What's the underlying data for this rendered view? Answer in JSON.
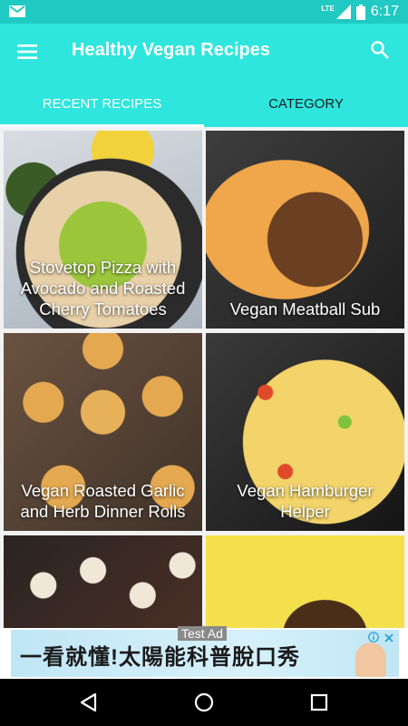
{
  "status_bar": {
    "network": "LTE",
    "battery_level": "2",
    "time": "6:17",
    "icons": [
      "mail-icon",
      "signal-icon",
      "battery-icon"
    ]
  },
  "app_bar": {
    "title": "Healthy Vegan Recipes",
    "icons": [
      "menu-icon",
      "search-icon"
    ]
  },
  "tabs": [
    {
      "label": "RECENT RECIPES",
      "selected": true
    },
    {
      "label": "CATEGORY",
      "selected": false
    }
  ],
  "recipes": [
    {
      "title": "Stovetop Pizza with Avocado and Roasted Cherry Tomatoes"
    },
    {
      "title": "Vegan Meatball Sub"
    },
    {
      "title": "Vegan Roasted Garlic and Herb Dinner Rolls"
    },
    {
      "title": "Vegan Hamburger Helper"
    },
    {
      "title": ""
    },
    {
      "title": ""
    }
  ],
  "ad": {
    "label": "Test Ad",
    "text": "一看就懂!太陽能科普脫口秀",
    "icons": [
      "info-icon",
      "close-icon"
    ]
  },
  "nav_bar": {
    "icons": [
      "back-icon",
      "home-icon",
      "recents-icon"
    ]
  },
  "colors": {
    "status_bar": "#20c9c1",
    "app_bar": "#2ee6dd",
    "tab_active_text": "#ffffff",
    "tab_inactive_text": "#1f1f1f",
    "nav_bar": "#000000"
  }
}
